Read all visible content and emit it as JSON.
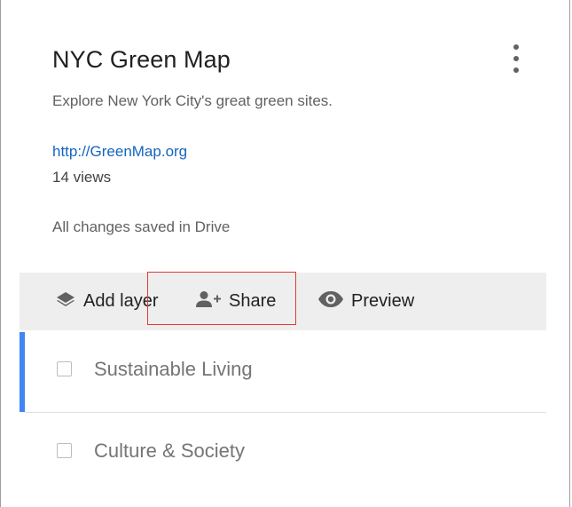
{
  "map": {
    "title": "NYC Green Map",
    "description": "Explore New York City's great green sites.",
    "link": "http://GreenMap.org",
    "views": "14 views",
    "save_status": "All changes saved in Drive"
  },
  "toolbar": {
    "add_layer_label": "Add layer",
    "add_layer_icon": "layers-icon",
    "share_label": "Share",
    "share_icon": "person-add-icon",
    "preview_label": "Preview",
    "preview_icon": "eye-icon"
  },
  "layers": [
    {
      "label": "Sustainable Living",
      "selected": true,
      "checked": false
    },
    {
      "label": "Culture & Society",
      "selected": false,
      "checked": false
    }
  ],
  "colors": {
    "accent": "#4285f4",
    "link": "#1565c0",
    "highlight_box": "#e53935",
    "toolbar_bg": "#eeeeee"
  }
}
